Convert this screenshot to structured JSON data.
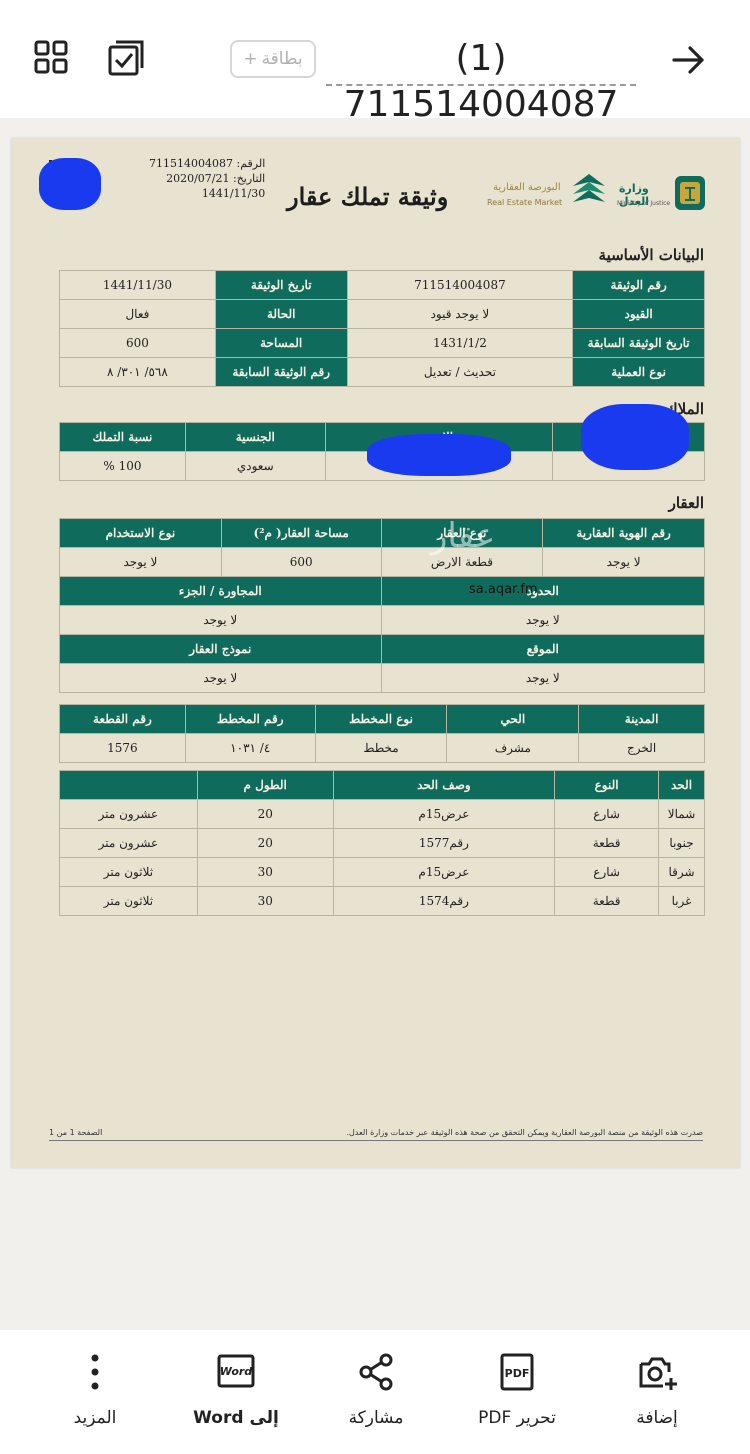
{
  "topbar": {
    "card_chip_label": "بطاقة",
    "card_chip_plus": "+",
    "doc_title": "(1) 711514004087"
  },
  "document": {
    "meta": {
      "number_label": "الرقم:",
      "number": "711514004087",
      "date_label": "التاريخ:",
      "date_gregorian": "2020/07/21",
      "date_hijri": "1441/11/30"
    },
    "title": "وثيقة تملك عقار",
    "logos": {
      "market_ar": "البورصة العقارية",
      "market_en": "Real Estate Market",
      "ministry_ar": "وزارة العدل",
      "ministry_en": "Ministry of Justice"
    },
    "basic": {
      "section_title": "البيانات الأساسية",
      "rows": [
        {
          "label_r": "رقم الوثيقة",
          "value_r": "711514004087",
          "label_l": "تاريخ الوثيقة",
          "value_l": "1441/11/30"
        },
        {
          "label_r": "القيود",
          "value_r": "لا يوجد قيود",
          "label_l": "الحالة",
          "value_l": "فعال"
        },
        {
          "label_r": "تاريخ الوثيقة السابقة",
          "value_r": "1431/1/2",
          "label_l": "المساحة",
          "value_l": "600"
        },
        {
          "label_r": "نوع العملية",
          "value_r": "تحديث / تعديل",
          "label_l": "رقم الوثيقة السابقة",
          "value_l": "٥٦٨/ ٣٠١/ ٨"
        }
      ]
    },
    "owners": {
      "section_title": "الملاك",
      "headers": [
        "",
        "الاسم",
        "الجنسية",
        "نسبة التملك"
      ],
      "row": [
        "",
        "",
        "سعودي",
        "100 %"
      ]
    },
    "property": {
      "section_title": "العقار",
      "headers1": [
        "رقم الهوية العقارية",
        "نوع العقار",
        "مساحة العقار( م²)",
        "نوع الاستخدام"
      ],
      "values1": [
        "لا يوجد",
        "قطعة الارض",
        "600",
        "لا يوجد"
      ],
      "band2_r": "الحدود",
      "band2_l": "المجاورة / الجزء",
      "values2_r": "لا يوجد",
      "values2_l": "لا يوجد",
      "band3_r": "الموقع",
      "band3_l": "نموذج العقار",
      "values3_r": "لا يوجد",
      "values3_l": "لا يوجد",
      "headers4": [
        "المدينة",
        "الحي",
        "نوع المخطط",
        "رقم المخطط",
        "رقم القطعة"
      ],
      "values4": [
        "الخرج",
        "مشرف",
        "مخطط",
        "٤/ ١٠٣١",
        "1576"
      ]
    },
    "bounds": {
      "headers": [
        "الحد",
        "النوع",
        "وصف الحد",
        "الطول م",
        ""
      ],
      "rows": [
        [
          "شمالا",
          "شارع",
          "عرض15م",
          "20",
          "عشرون متر"
        ],
        [
          "جنوبا",
          "قطعة",
          "رقم1577",
          "20",
          "عشرون متر"
        ],
        [
          "شرقا",
          "شارع",
          "عرض15م",
          "30",
          "ثلاثون متر"
        ],
        [
          "غربا",
          "قطعة",
          "رقم1574",
          "30",
          "ثلاثون متر"
        ]
      ]
    },
    "footer": {
      "note": "صدرت هذه الوثيقة من منصة البورصة العقارية ويمكن التحقق من صحة هذه الوثيقة عبر خدمات وزارة العدل.",
      "page": "الصفحة 1 من 1"
    },
    "watermark": {
      "logo": "عقار",
      "url": "sa.aqar.fm"
    }
  },
  "bottombar": {
    "items": [
      {
        "label": "إضافة",
        "icon": "add-photo-icon"
      },
      {
        "label": "تحرير PDF",
        "icon": "pdf-edit-icon"
      },
      {
        "label": "مشاركة",
        "icon": "share-icon"
      },
      {
        "label": "إلى Word",
        "icon": "word-icon"
      },
      {
        "label": "المزيد",
        "icon": "more-icon"
      }
    ],
    "pdf_icon_text": "PDF",
    "word_icon_text": "Word"
  },
  "colors": {
    "header_green": "#0f6b5c",
    "paper": "#e8e3d0",
    "redaction_blue": "#1a3af0"
  }
}
